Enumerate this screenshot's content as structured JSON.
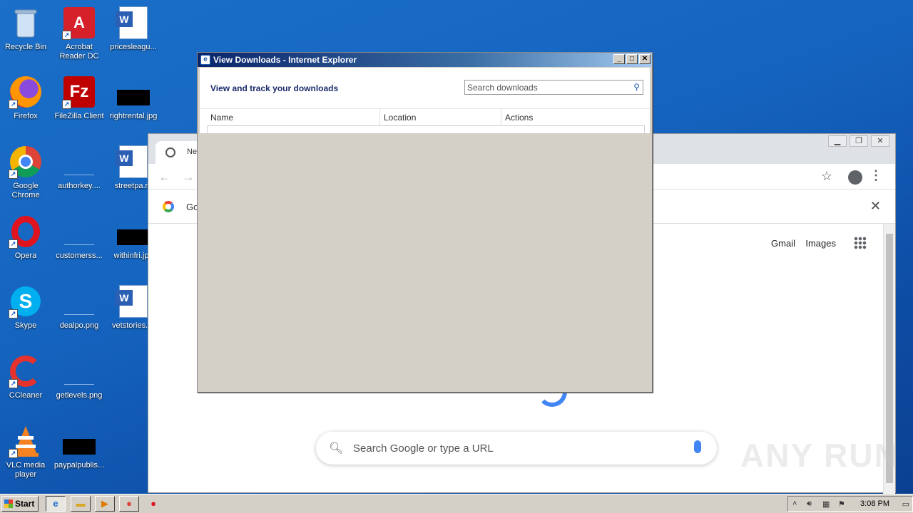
{
  "desktop": {
    "icons": [
      {
        "label": "Recycle Bin",
        "icon": "recycle-bin-icon"
      },
      {
        "label": "Acrobat Reader DC",
        "icon": "acrobat-icon"
      },
      {
        "label": "pricesleagu...",
        "icon": "word-doc-icon"
      },
      {
        "label": "Firefox",
        "icon": "firefox-icon"
      },
      {
        "label": "FileZilla Client",
        "icon": "filezilla-icon"
      },
      {
        "label": "rightrental.jpg",
        "icon": "image-file-icon"
      },
      {
        "label": "Google Chrome",
        "icon": "chrome-icon"
      },
      {
        "label": "authorkey....",
        "icon": "image-file-icon"
      },
      {
        "label": "streetpa.rtf",
        "icon": "word-doc-icon"
      },
      {
        "label": "Opera",
        "icon": "opera-icon"
      },
      {
        "label": "customerss...",
        "icon": "image-file-icon"
      },
      {
        "label": "withinfri.jpg",
        "icon": "image-file-icon"
      },
      {
        "label": "Skype",
        "icon": "skype-icon"
      },
      {
        "label": "dealpo.png",
        "icon": "image-file-icon"
      },
      {
        "label": "vetstories.rtf",
        "icon": "word-doc-icon"
      },
      {
        "label": "CCleaner",
        "icon": "ccleaner-icon"
      },
      {
        "label": "getlevels.png",
        "icon": "image-file-icon"
      },
      {
        "label": "VLC media player",
        "icon": "vlc-icon"
      },
      {
        "label": "paypalpublis...",
        "icon": "image-file-icon"
      }
    ]
  },
  "chrome": {
    "tab_title": "New Tab",
    "info_text": "Go",
    "header_links": {
      "gmail": "Gmail",
      "images": "Images"
    },
    "search_placeholder": "Search Google or type a URL"
  },
  "ie_downloads": {
    "title": "View Downloads - Internet Explorer",
    "heading": "View and track your downloads",
    "search_placeholder": "Search downloads",
    "columns": [
      "Name",
      "Location",
      "Actions"
    ]
  },
  "watermark": "ANY RUN",
  "taskbar": {
    "start_label": "Start",
    "clock": "3:08 PM"
  }
}
